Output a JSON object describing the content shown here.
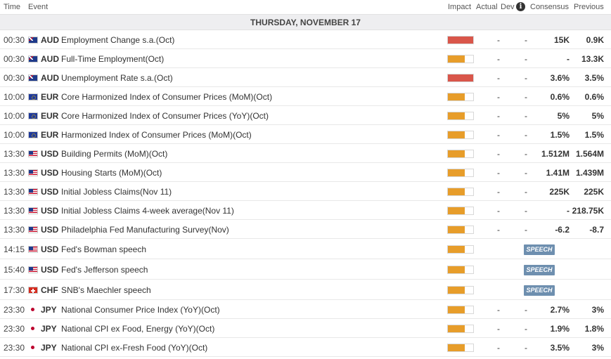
{
  "header": {
    "time": "Time",
    "event": "Event",
    "impact": "Impact",
    "actual": "Actual",
    "dev": "Dev",
    "info_icon": "i",
    "consensus": "Consensus",
    "previous": "Previous"
  },
  "date_label": "THURSDAY, NOVEMBER 17",
  "colors": {
    "high": "#d9564a",
    "medium": "#e79d2a",
    "speech": "#6e8faf"
  },
  "events": [
    {
      "time": "00:30",
      "flag": "au",
      "currency": "AUD",
      "event": "Employment Change s.a.(Oct)",
      "impact": "high",
      "impact_level": 1.0,
      "actual": "-",
      "dev": "-",
      "consensus": "15K",
      "previous": "0.9K"
    },
    {
      "time": "00:30",
      "flag": "au",
      "currency": "AUD",
      "event": "Full-Time Employment(Oct)",
      "impact": "medium",
      "impact_level": 0.66,
      "actual": "-",
      "dev": "-",
      "consensus": "-",
      "previous": "13.3K"
    },
    {
      "time": "00:30",
      "flag": "au",
      "currency": "AUD",
      "event": "Unemployment Rate s.a.(Oct)",
      "impact": "high",
      "impact_level": 1.0,
      "actual": "-",
      "dev": "-",
      "consensus": "3.6%",
      "previous": "3.5%"
    },
    {
      "time": "10:00",
      "flag": "eu",
      "currency": "EUR",
      "event": "Core Harmonized Index of Consumer Prices (MoM)(Oct)",
      "impact": "medium",
      "impact_level": 0.66,
      "actual": "-",
      "dev": "-",
      "consensus": "0.6%",
      "previous": "0.6%"
    },
    {
      "time": "10:00",
      "flag": "eu",
      "currency": "EUR",
      "event": "Core Harmonized Index of Consumer Prices (YoY)(Oct)",
      "impact": "medium",
      "impact_level": 0.66,
      "actual": "-",
      "dev": "-",
      "consensus": "5%",
      "previous": "5%"
    },
    {
      "time": "10:00",
      "flag": "eu",
      "currency": "EUR",
      "event": "Harmonized Index of Consumer Prices (MoM)(Oct)",
      "impact": "medium",
      "impact_level": 0.66,
      "actual": "-",
      "dev": "-",
      "consensus": "1.5%",
      "previous": "1.5%"
    },
    {
      "time": "13:30",
      "flag": "us",
      "currency": "USD",
      "event": "Building Permits (MoM)(Oct)",
      "impact": "medium",
      "impact_level": 0.66,
      "actual": "-",
      "dev": "-",
      "consensus": "1.512M",
      "previous": "1.564M"
    },
    {
      "time": "13:30",
      "flag": "us",
      "currency": "USD",
      "event": "Housing Starts (MoM)(Oct)",
      "impact": "medium",
      "impact_level": 0.66,
      "actual": "-",
      "dev": "-",
      "consensus": "1.41M",
      "previous": "1.439M"
    },
    {
      "time": "13:30",
      "flag": "us",
      "currency": "USD",
      "event": "Initial Jobless Claims(Nov 11)",
      "impact": "medium",
      "impact_level": 0.66,
      "actual": "-",
      "dev": "-",
      "consensus": "225K",
      "previous": "225K"
    },
    {
      "time": "13:30",
      "flag": "us",
      "currency": "USD",
      "event": "Initial Jobless Claims 4-week average(Nov 11)",
      "impact": "medium",
      "impact_level": 0.66,
      "actual": "-",
      "dev": "-",
      "consensus": "-",
      "previous": "218.75K"
    },
    {
      "time": "13:30",
      "flag": "us",
      "currency": "USD",
      "event": "Philadelphia Fed Manufacturing Survey(Nov)",
      "impact": "medium",
      "impact_level": 0.66,
      "actual": "-",
      "dev": "-",
      "consensus": "-6.2",
      "previous": "-8.7"
    },
    {
      "time": "14:15",
      "flag": "us",
      "currency": "USD",
      "event": "Fed's Bowman speech",
      "impact": "medium",
      "impact_level": 0.66,
      "speech": "SPEECH"
    },
    {
      "time": "15:40",
      "flag": "us",
      "currency": "USD",
      "event": "Fed's Jefferson speech",
      "impact": "medium",
      "impact_level": 0.66,
      "speech": "SPEECH"
    },
    {
      "time": "17:30",
      "flag": "ch",
      "currency": "CHF",
      "event": "SNB's Maechler speech",
      "impact": "medium",
      "impact_level": 0.66,
      "speech": "SPEECH"
    },
    {
      "time": "23:30",
      "flag": "jp",
      "currency": "JPY",
      "event": "National Consumer Price Index (YoY)(Oct)",
      "impact": "medium",
      "impact_level": 0.66,
      "actual": "-",
      "dev": "-",
      "consensus": "2.7%",
      "previous": "3%"
    },
    {
      "time": "23:30",
      "flag": "jp",
      "currency": "JPY",
      "event": "National CPI ex Food, Energy (YoY)(Oct)",
      "impact": "medium",
      "impact_level": 0.66,
      "actual": "-",
      "dev": "-",
      "consensus": "1.9%",
      "previous": "1.8%"
    },
    {
      "time": "23:30",
      "flag": "jp",
      "currency": "JPY",
      "event": "National CPI ex-Fresh Food (YoY)(Oct)",
      "impact": "medium",
      "impact_level": 0.66,
      "actual": "-",
      "dev": "-",
      "consensus": "3.5%",
      "previous": "3%"
    }
  ]
}
